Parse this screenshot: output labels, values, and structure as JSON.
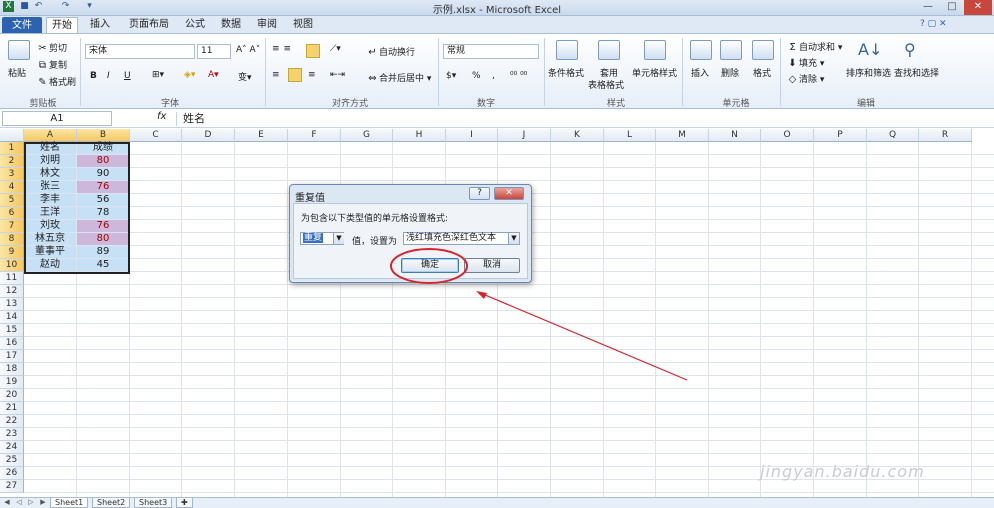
{
  "title": "示例.xlsx - Microsoft Excel",
  "tabs": {
    "file": "文件",
    "items": [
      "开始",
      "插入",
      "页面布局",
      "公式",
      "数据",
      "审阅",
      "视图"
    ]
  },
  "ribbon": {
    "clipboard": {
      "paste": "粘贴",
      "cut": "剪切",
      "copy": "复制",
      "format_painter": "格式刷",
      "label": "剪贴板"
    },
    "font": {
      "name": "宋体",
      "size": "11",
      "label": "字体",
      "bold": "B",
      "italic": "I",
      "underline": "U"
    },
    "align": {
      "wrap": "自动换行",
      "merge": "合并后居中",
      "label": "对齐方式"
    },
    "number": {
      "format": "常规",
      "percent": "%",
      "comma": ",",
      "label": "数字"
    },
    "styles": {
      "cond": "条件格式",
      "table": "套用",
      "table2": "表格格式",
      "cell": "单元格样式",
      "label": "样式"
    },
    "cells": {
      "insert": "插入",
      "delete": "删除",
      "format": "格式",
      "label": "单元格"
    },
    "editing": {
      "autosum": "自动求和",
      "fill": "填充",
      "clear": "清除",
      "sort": "排序和筛选",
      "find": "查找和选择",
      "label": "编辑"
    }
  },
  "formula_bar": {
    "name_box": "A1",
    "fx": "fx",
    "value": "姓名"
  },
  "columns": [
    "A",
    "B",
    "C",
    "D",
    "E",
    "F",
    "G",
    "H",
    "I",
    "J",
    "K",
    "L",
    "M",
    "N",
    "O",
    "P",
    "Q",
    "R"
  ],
  "rows": [
    "1",
    "2",
    "3",
    "4",
    "5",
    "6",
    "7",
    "8",
    "9",
    "10",
    "11",
    "12",
    "13",
    "14",
    "15",
    "16",
    "17",
    "18",
    "19",
    "20",
    "21",
    "22",
    "23",
    "24",
    "25",
    "26",
    "27"
  ],
  "table": [
    [
      "姓名",
      "成绩"
    ],
    [
      "刘明",
      "80"
    ],
    [
      "林文",
      "90"
    ],
    [
      "张三",
      "76"
    ],
    [
      "李丰",
      "56"
    ],
    [
      "王洋",
      "78"
    ],
    [
      "刘玫",
      "76"
    ],
    [
      "林五京",
      "80"
    ],
    [
      "董事平",
      "89"
    ],
    [
      "赵动",
      "45"
    ]
  ],
  "duplicate_rows": [
    1,
    3,
    6,
    7
  ],
  "colors": {
    "cell_fill": "#c6e0f5",
    "dup_fill": "#cdb8dc",
    "dup_text": "#9c0006",
    "accent": "#2c63b1"
  },
  "sheet_tabs": [
    "Sheet1",
    "Sheet2",
    "Sheet3"
  ],
  "dialog": {
    "title": "重复值",
    "help": "?",
    "close": "✕",
    "prompt": "为包含以下类型值的单元格设置格式:",
    "type_value": "重复",
    "mid_label": "值，设置为",
    "format_value": "浅红填充色深红色文本",
    "ok": "确定",
    "cancel": "取消"
  },
  "watermark": "jingyan.baidu.com"
}
